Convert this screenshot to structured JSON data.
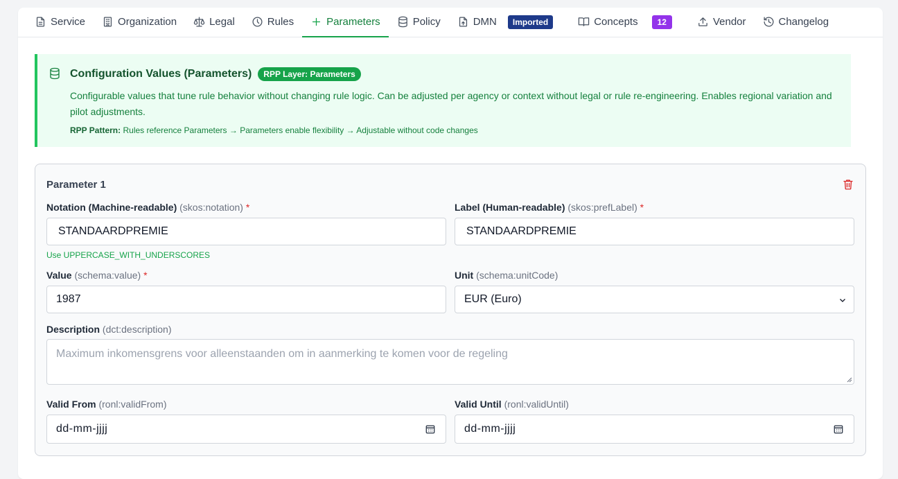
{
  "tabs": [
    {
      "label": "Service",
      "icon": "document-icon"
    },
    {
      "label": "Organization",
      "icon": "building-icon"
    },
    {
      "label": "Legal",
      "icon": "scale-icon"
    },
    {
      "label": "Rules",
      "icon": "clock-icon"
    },
    {
      "label": "Parameters",
      "icon": "plus-icon",
      "active": true
    },
    {
      "label": "Policy",
      "icon": "database-icon"
    },
    {
      "label": "DMN",
      "icon": "file-upload-icon",
      "badge": "Imported"
    },
    {
      "label": "Concepts",
      "icon": "book-icon",
      "badge": "12"
    },
    {
      "label": "Vendor",
      "icon": "upload-icon"
    },
    {
      "label": "Changelog",
      "icon": "history-icon"
    }
  ],
  "info": {
    "title": "Configuration Values (Parameters)",
    "badge": "RPP Layer: Parameters",
    "description": "Configurable values that tune rule behavior without changing rule logic. Can be adjusted per agency or context without legal or rule re-engineering. Enables regional variation and pilot adjustments.",
    "pattern_label": "RPP Pattern:",
    "pattern_text": "Rules reference Parameters → Parameters enable flexibility → Adjustable without code changes"
  },
  "parameter": {
    "title": "Parameter 1",
    "notation": {
      "label": "Notation (Machine-readable)",
      "hint": "(skos:notation)",
      "required": "*",
      "value": "STANDAARDPREMIE",
      "help": "Use UPPERCASE_WITH_UNDERSCORES"
    },
    "pref_label": {
      "label": "Label (Human-readable)",
      "hint": "(skos:prefLabel)",
      "required": "*",
      "value": "STANDAARDPREMIE"
    },
    "value": {
      "label": "Value",
      "hint": "(schema:value)",
      "required": "*",
      "value": "1987"
    },
    "unit": {
      "label": "Unit",
      "hint": "(schema:unitCode)",
      "selected": "EUR (Euro)"
    },
    "description": {
      "label": "Description",
      "hint": "(dct:description)",
      "placeholder": "Maximum inkomensgrens voor alleenstaanden om in aanmerking te komen voor de regeling"
    },
    "valid_from": {
      "label": "Valid From",
      "hint": "(ronl:validFrom)",
      "placeholder": "dd-mm-jjjj"
    },
    "valid_until": {
      "label": "Valid Until",
      "hint": "(ronl:validUntil)",
      "placeholder": "dd-mm-jjjj"
    }
  },
  "colors": {
    "accent": "#16a34a",
    "imported_badge": "#1e3a8a",
    "concepts_badge": "#9333ea",
    "delete": "#dc2626"
  }
}
